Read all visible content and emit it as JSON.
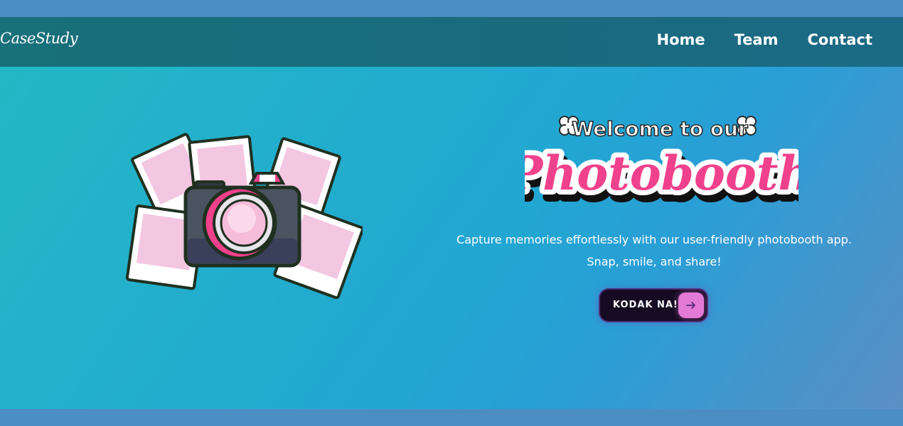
{
  "brand": {
    "name": "CaseStudy"
  },
  "nav": {
    "items": [
      {
        "label": "Home"
      },
      {
        "label": "Team"
      },
      {
        "label": "Contact"
      }
    ]
  },
  "hero": {
    "welcome": "Welcome to our",
    "title": "Photobooth",
    "tagline_line1": "Capture memories effortlessly with our user-friendly photobooth app.",
    "tagline_line2": "Snap, smile, and share!",
    "cta_label": "KODAK NA!",
    "cta_icon": "arrow-right-icon",
    "illustration_icon": "camera-with-polaroids-icon"
  },
  "colors": {
    "navbar": "#18707a",
    "hero_start": "#23b8c6",
    "hero_end": "#5b8fc4",
    "accent_pink": "#f0418c",
    "button_bg": "#150b22",
    "button_arrow_bg": "#e27ad6"
  }
}
